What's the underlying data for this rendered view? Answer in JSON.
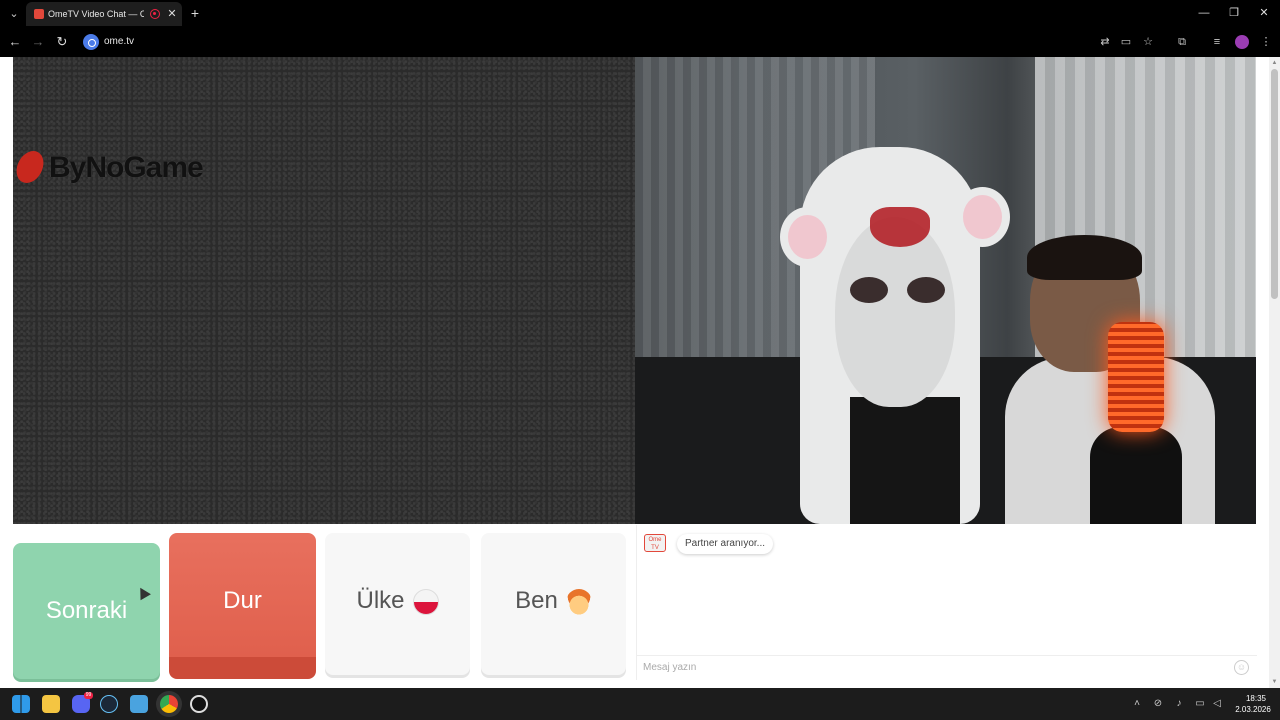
{
  "browser": {
    "tab_title": "OmeTV Video Chat — Ome",
    "url": "ome.tv",
    "new_tab_label": "+",
    "close_tab_label": "✕"
  },
  "left_video": {
    "logo_text": "ByNoGame"
  },
  "controls": {
    "next_label": "Sonraki",
    "stop_label": "Dur",
    "country_label": "Ülke",
    "me_label": "Ben",
    "next_color": "#8fd4ae",
    "stop_color": "#e0604d"
  },
  "chat": {
    "logo_text": "Ome TV",
    "status_message": "Partner aranıyor...",
    "input_placeholder": "Mesaj yazın"
  },
  "taskbar": {
    "time": "18:35",
    "date": "2.03.2026",
    "discord_badge": "99"
  },
  "icons": [
    "chevron-down-icon",
    "record-icon",
    "close-icon",
    "back-icon",
    "forward-icon",
    "reload-icon",
    "translate-icon",
    "cast-icon",
    "star-icon",
    "extensions-icon",
    "media-icon",
    "menu-icon",
    "windows-icon",
    "folder-icon",
    "discord-icon",
    "steam-icon",
    "chrome-icon",
    "obs-icon",
    "emoji-icon",
    "flag-icon",
    "avatar-icon"
  ]
}
